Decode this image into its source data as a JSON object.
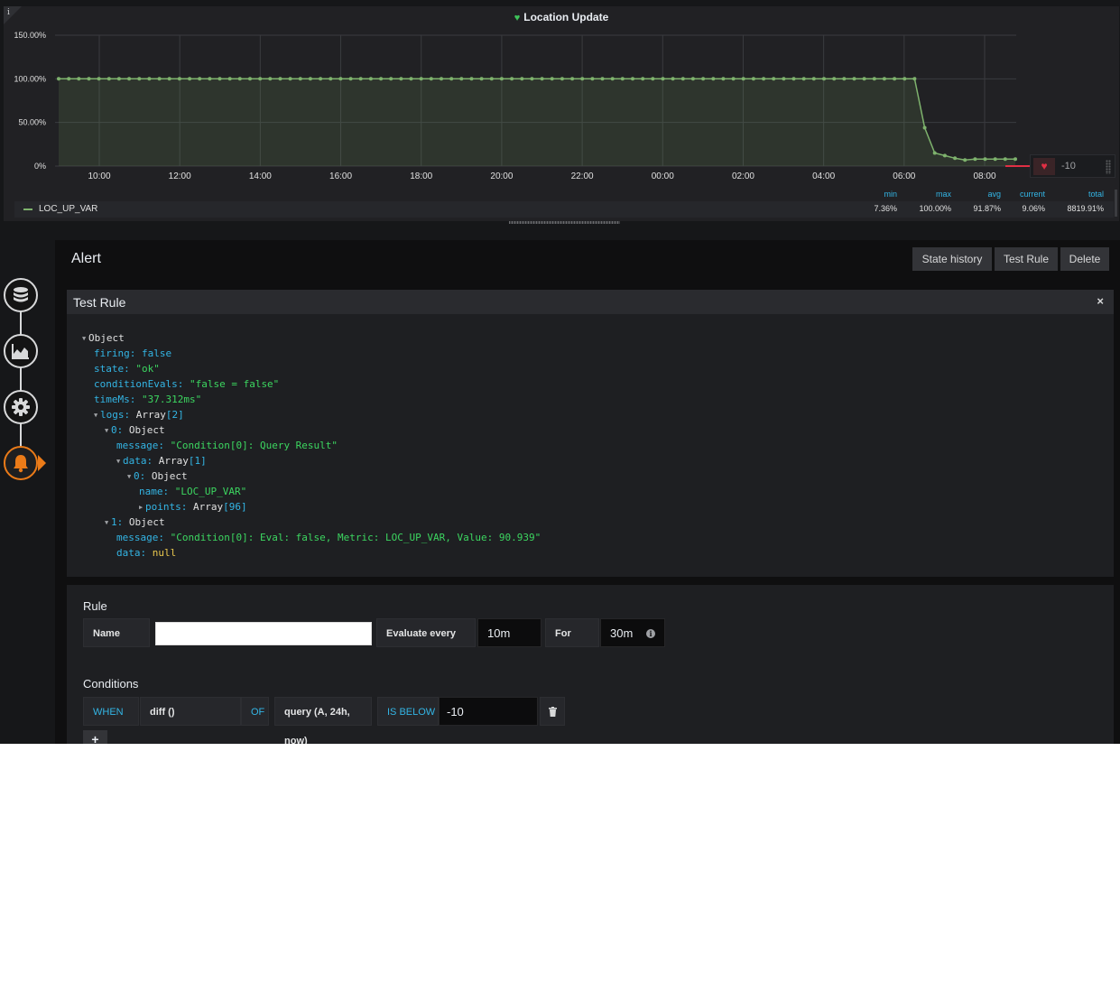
{
  "panel": {
    "info_glyph": "i",
    "title": "Location Update",
    "title_icon": "heart-icon",
    "threshold_value": "-10",
    "threshold_icon": "heart-broken-icon"
  },
  "chart_data": {
    "type": "line",
    "x_tick_labels": [
      "10:00",
      "12:00",
      "14:00",
      "16:00",
      "18:00",
      "20:00",
      "22:00",
      "00:00",
      "02:00",
      "04:00",
      "06:00",
      "08:00"
    ],
    "y_tick_labels": [
      "150.00%",
      "100.00%",
      "50.00%",
      "0%"
    ],
    "ylim": [
      0,
      150
    ],
    "grid": true,
    "threshold": -10,
    "series": [
      {
        "name": "LOC_UP_VAR",
        "color": "#7eb26d",
        "x_start": "09:00",
        "x_end": "08:45",
        "points_count": 96,
        "values": [
          100,
          100,
          100,
          100,
          100,
          100,
          100,
          100,
          100,
          100,
          100,
          100,
          100,
          100,
          100,
          100,
          100,
          100,
          100,
          100,
          100,
          100,
          100,
          100,
          100,
          100,
          100,
          100,
          100,
          100,
          100,
          100,
          100,
          100,
          100,
          100,
          100,
          100,
          100,
          100,
          100,
          100,
          100,
          100,
          100,
          100,
          100,
          100,
          100,
          100,
          100,
          100,
          100,
          100,
          100,
          100,
          100,
          100,
          100,
          100,
          100,
          100,
          100,
          100,
          100,
          100,
          100,
          100,
          100,
          100,
          100,
          100,
          100,
          100,
          100,
          100,
          100,
          100,
          100,
          100,
          100,
          100,
          100,
          100,
          100,
          100,
          44,
          15,
          12,
          9,
          7,
          8,
          8,
          8,
          8,
          8
        ]
      }
    ]
  },
  "legend": {
    "series_name": "LOC_UP_VAR",
    "headers": {
      "min": "min",
      "max": "max",
      "avg": "avg",
      "current": "current",
      "total": "total"
    },
    "values": {
      "min": "7.36%",
      "max": "100.00%",
      "avg": "91.87%",
      "current": "9.06%",
      "total": "8819.91%"
    }
  },
  "rail": {
    "icons": [
      "database-icon",
      "chart-icon",
      "gear-icon",
      "bell-icon"
    ]
  },
  "alert": {
    "title": "Alert",
    "buttons": {
      "state_history": "State history",
      "test_rule": "Test Rule",
      "delete": "Delete"
    }
  },
  "test_rule": {
    "title": "Test Rule",
    "close_glyph": "×",
    "tree": {
      "root": "Object",
      "firing_key": "firing:",
      "firing_val": "false",
      "state_key": "state:",
      "state_val": "\"ok\"",
      "cond_key": "conditionEvals:",
      "cond_val": "\"false = false\"",
      "time_key": "timeMs:",
      "time_val": "\"37.312ms\"",
      "logs_key": "logs:",
      "logs_type": "Array",
      "logs_len": "[2]",
      "log0_key": "0:",
      "log0_type": "Object",
      "log0_msg_key": "message:",
      "log0_msg_val": "\"Condition[0]: Query Result\"",
      "log0_data_key": "data:",
      "log0_data_type": "Array",
      "log0_data_len": "[1]",
      "d0_key": "0:",
      "d0_type": "Object",
      "d0_name_key": "name:",
      "d0_name_val": "\"LOC_UP_VAR\"",
      "d0_points_key": "points:",
      "d0_points_type": "Array",
      "d0_points_len": "[96]",
      "log1_key": "1:",
      "log1_type": "Object",
      "log1_msg_key": "message:",
      "log1_msg_val": "\"Condition[0]: Eval: false, Metric: LOC_UP_VAR, Value: 90.939\"",
      "log1_data_key": "data:",
      "log1_data_val": "null"
    }
  },
  "rule": {
    "title": "Rule",
    "name_label": "Name",
    "name_value": "",
    "evaluate_label": "Evaluate every",
    "evaluate_value": "10m",
    "for_label": "For",
    "for_value": "30m",
    "info_glyph": "i"
  },
  "conditions": {
    "title": "Conditions",
    "when": "WHEN",
    "reducer": "diff ()",
    "of": "OF",
    "query": "query (A, 24h, now)",
    "evaluator": "IS BELOW",
    "threshold": "-10",
    "trash_icon": "trash-icon",
    "add_glyph": "+"
  }
}
